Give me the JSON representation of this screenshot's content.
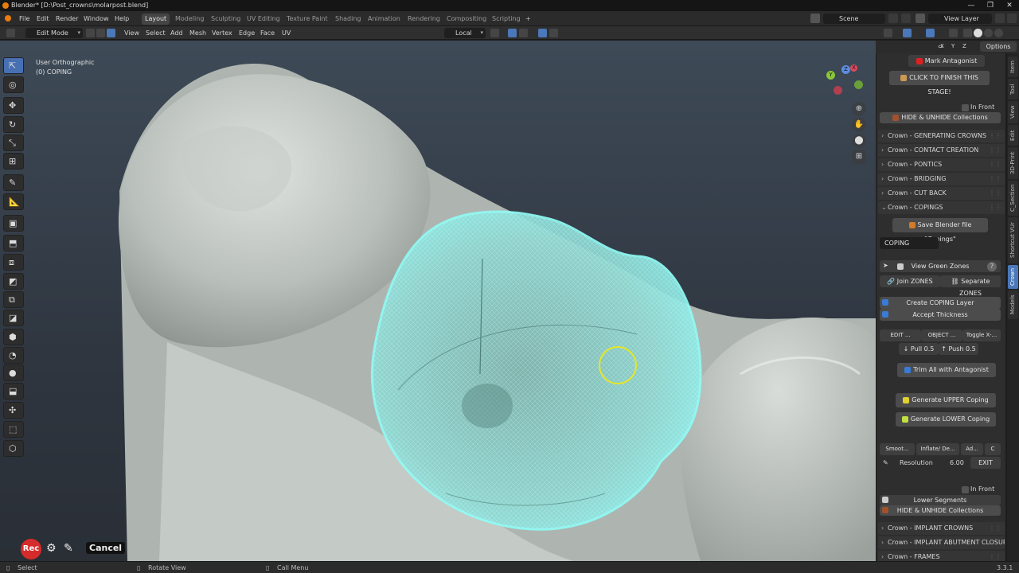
{
  "window": {
    "title": "Blender* [D:\\Post_crowns\\molarpost.blend]",
    "controls": [
      "—",
      "❐",
      "✕"
    ]
  },
  "menu": {
    "items": [
      "File",
      "Edit",
      "Render",
      "Window",
      "Help"
    ],
    "workspaces": [
      "Layout",
      "Modeling",
      "Sculpting",
      "UV Editing",
      "Texture Paint",
      "Shading",
      "Animation",
      "Rendering",
      "Compositing",
      "Scripting"
    ],
    "active_workspace": "Layout",
    "add_tab": "+",
    "scene_label": "Scene",
    "view_layer_label": "View Layer"
  },
  "header": {
    "mode": "Edit Mode",
    "menus": [
      "View",
      "Select",
      "Add",
      "Mesh",
      "Vertex",
      "Edge",
      "Face",
      "UV"
    ],
    "orientation": "Local"
  },
  "viewport": {
    "view_name": "User Orthographic",
    "object_label": "(0) COPING",
    "gizmo_axes": [
      "X",
      "Y",
      "Z"
    ],
    "coping_color": "#7ff3f0",
    "brush_color": "#e5e52a"
  },
  "options_label": "Options",
  "axis_toggles": [
    "X",
    "Y",
    "Z"
  ],
  "panel": {
    "mark_antagonist": "Mark Antagonist",
    "finish_stage": "CLICK TO FINISH THIS STAGE!",
    "in_front_1": "In Front",
    "hide_unhide_1": "HIDE & UNHIDE Collections",
    "sections_top": [
      "Crown - GENERATING CROWNS",
      "Crown - CONTACT CREATION",
      "Crown - PONTICS",
      "Crown - BRIDGING",
      "Crown - CUT BACK"
    ],
    "copings_section": "Crown - COPINGS",
    "save_file": "Save Blender file \"Copings\"",
    "coping_field": "COPING",
    "view_green_zones": "View Green Zones",
    "help_glyph": "?",
    "join_zones": "Join ZONES",
    "separate_zones": "Separate ZONES",
    "create_layer": "Create COPING Layer",
    "accept_thickness": "Accept Thickness",
    "edit_btn": "EDIT ...",
    "object_btn": "OBJECT ...",
    "toggle_btn": "Toggle X-...",
    "pull": "Pull 0.5",
    "push": "Push 0.5",
    "trim": "Trim All with Antagonist",
    "gen_upper": "Generate  UPPER Coping",
    "gen_lower": "Generate LOWER Coping",
    "smooth": "Smoot...",
    "inflate": "Inflate/ De...",
    "ad": "Ad...",
    "c": "C",
    "resolution_label": "Resolution",
    "resolution_value": "6.00",
    "exit": "EXIT",
    "in_front_2": "In Front",
    "lower_segments": "Lower Segments",
    "hide_unhide_2": "HIDE & UNHIDE Collections",
    "sections_bottom": [
      "Crown - IMPLANT CROWNS",
      "Crown - IMPLANT  ABUTMENT CLOSURE",
      "Crown - FRAMES"
    ]
  },
  "side_tabs": [
    "Item",
    "Tool",
    "View",
    "Edit",
    "3D-Print",
    "C_Section",
    "Shortcut VUr",
    "Crown",
    "Models"
  ],
  "active_side_tab": "Crown",
  "status": {
    "select": "Select",
    "rotate": "Rotate View",
    "call_menu": "Call Menu",
    "version": "3.3.1"
  },
  "recorder": {
    "rec": "Rec",
    "cancel": "Cancel"
  }
}
